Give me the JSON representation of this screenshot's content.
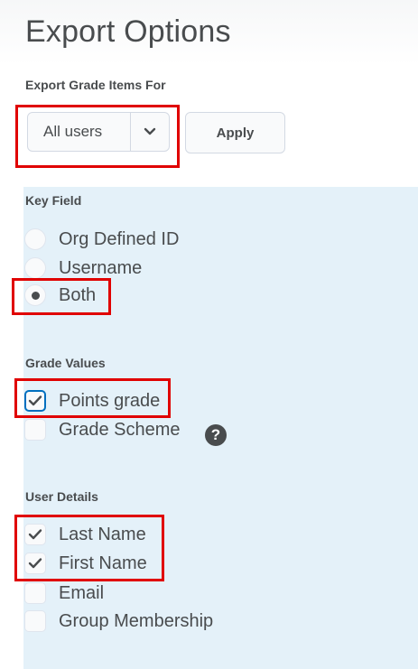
{
  "page": {
    "title": "Export Options"
  },
  "export_for": {
    "label": "Export Grade Items For",
    "selected": "All users",
    "apply_label": "Apply"
  },
  "key_field": {
    "label": "Key Field",
    "options": [
      {
        "label": "Org Defined ID",
        "checked": false
      },
      {
        "label": "Username",
        "checked": false
      },
      {
        "label": "Both",
        "checked": true
      }
    ]
  },
  "grade_values": {
    "label": "Grade Values",
    "options": [
      {
        "label": "Points grade",
        "checked": true
      },
      {
        "label": "Grade Scheme",
        "checked": false
      }
    ],
    "help_glyph": "?"
  },
  "user_details": {
    "label": "User Details",
    "options": [
      {
        "label": "Last Name",
        "checked": true
      },
      {
        "label": "First Name",
        "checked": true
      },
      {
        "label": "Email",
        "checked": false
      },
      {
        "label": "Group Membership",
        "checked": false
      }
    ]
  },
  "colors": {
    "panel_background": "#e4f1f9",
    "text": "#494c4e",
    "focus_ring": "#006fbf",
    "annotation_highlight": "#e00000"
  }
}
